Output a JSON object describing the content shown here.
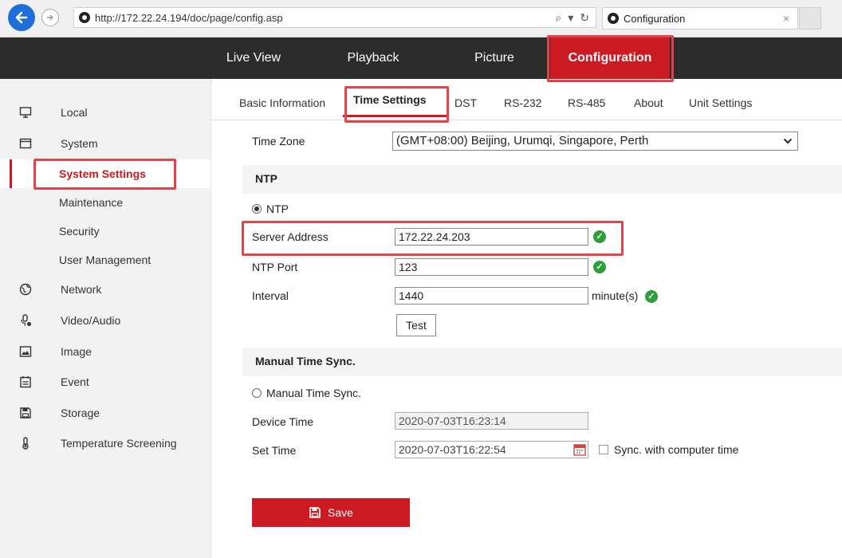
{
  "browser": {
    "url": "http://172.22.24.194/doc/page/config.asp",
    "tab_title": "Configuration",
    "tab_close": "×",
    "search_icon": "⌕",
    "dropdown_icon": "▾",
    "refresh_icon": "↻"
  },
  "nav": {
    "items": [
      {
        "label": "Live View"
      },
      {
        "label": "Playback"
      },
      {
        "label": "Picture"
      },
      {
        "label": "Configuration",
        "active": true
      }
    ]
  },
  "sidebar": {
    "items": [
      {
        "label": "Local",
        "icon": "monitor-icon"
      },
      {
        "label": "System",
        "icon": "window-icon"
      },
      {
        "label": "System Settings",
        "active": true
      },
      {
        "label": "Maintenance"
      },
      {
        "label": "Security"
      },
      {
        "label": "User Management"
      },
      {
        "label": "Network",
        "icon": "globe-icon"
      },
      {
        "label": "Video/Audio",
        "icon": "microphone-icon"
      },
      {
        "label": "Image",
        "icon": "image-icon"
      },
      {
        "label": "Event",
        "icon": "calendar-icon"
      },
      {
        "label": "Storage",
        "icon": "floppy-icon"
      },
      {
        "label": "Temperature Screening",
        "icon": "thermometer-icon"
      }
    ]
  },
  "subtabs": [
    {
      "label": "Basic Information"
    },
    {
      "label": "Time Settings",
      "active": true
    },
    {
      "label": "DST"
    },
    {
      "label": "RS-232"
    },
    {
      "label": "RS-485"
    },
    {
      "label": "About"
    },
    {
      "label": "Unit Settings"
    }
  ],
  "form": {
    "time_zone_label": "Time Zone",
    "time_zone_value": "(GMT+08:00) Beijing, Urumqi, Singapore, Perth",
    "ntp_section": "NTP",
    "ntp_radio_label": "NTP",
    "server_address_label": "Server Address",
    "server_address_value": "172.22.24.203",
    "ntp_port_label": "NTP Port",
    "ntp_port_value": "123",
    "interval_label": "Interval",
    "interval_value": "1440",
    "interval_unit": "minute(s)",
    "test_label": "Test",
    "manual_section": "Manual Time Sync.",
    "manual_radio_label": "Manual Time Sync.",
    "device_time_label": "Device Time",
    "device_time_value": "2020-07-03T16:23:14",
    "set_time_label": "Set Time",
    "set_time_value": "2020-07-03T16:22:54",
    "sync_label": "Sync. with computer time",
    "save_label": "Save"
  },
  "colors": {
    "accent": "#cc1a22",
    "nav_bg": "#2c2c2c",
    "highlight": "#e0454a",
    "ok": "#2e9e3a"
  }
}
